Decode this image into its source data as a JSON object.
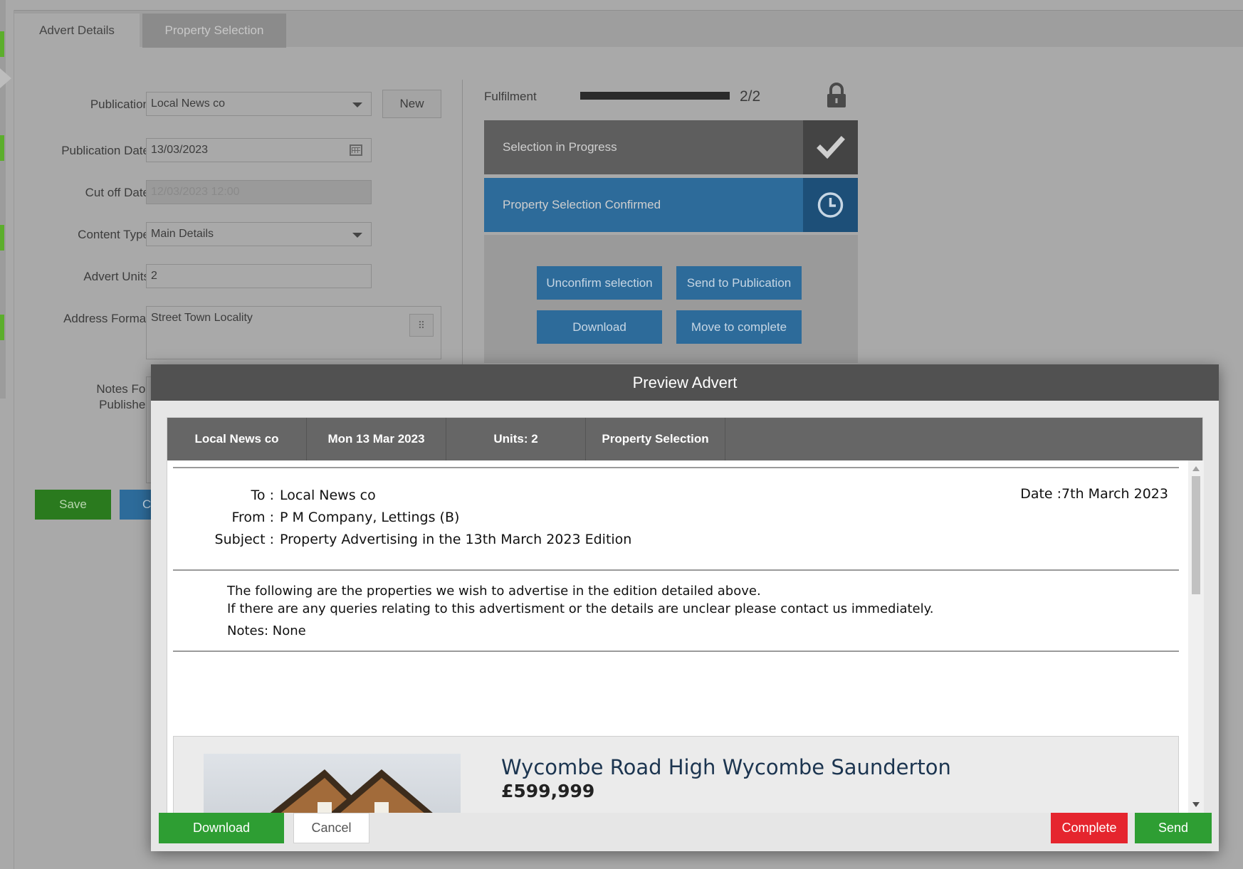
{
  "tabs": {
    "advert_details": "Advert Details",
    "property_selection": "Property Selection"
  },
  "form": {
    "publication": {
      "label": "Publication",
      "value": "Local News co"
    },
    "new_button": "New",
    "publication_date": {
      "label": "Publication Date",
      "value": "13/03/2023"
    },
    "cut_off_date": {
      "label": "Cut off Date",
      "value": "12/03/2023 12:00"
    },
    "content_type": {
      "label": "Content Type",
      "value": "Main Details"
    },
    "advert_units": {
      "label": "Advert Units",
      "value": "2"
    },
    "address_format": {
      "label": "Address Format",
      "value": "Street Town Locality"
    },
    "notes_label_line1": "Notes For",
    "notes_label_line2": "Publisher",
    "save_button": "Save",
    "cancel_button_partial": "C"
  },
  "fulfilment": {
    "label": "Fulfilment",
    "fraction": "2/2",
    "progress": 1.0,
    "stages": [
      {
        "label": "Selection in Progress",
        "icon": "check-icon"
      },
      {
        "label": "Property Selection Confirmed",
        "icon": "clock-icon"
      }
    ],
    "actions": {
      "unconfirm": "Unconfirm selection",
      "send_to_publication": "Send to Publication",
      "download": "Download",
      "move_to_complete": "Move to complete"
    }
  },
  "modal": {
    "title": "Preview Advert",
    "info": {
      "publication": "Local News co",
      "date": "Mon 13 Mar 2023",
      "units": "Units: 2",
      "section": "Property Selection"
    },
    "letter": {
      "to_key": "To :",
      "to_value": "Local News co",
      "from_key": "From :",
      "from_value": "P M Company, Lettings (B)",
      "subject_key": "Subject :",
      "subject_value": "Property Advertising in the 13th March 2023 Edition",
      "date": "Date :7th March 2023",
      "line1": "The following are the properties we wish to advertise in the edition detailed above.",
      "line2": "If there are any queries relating to this advertisment or the details are unclear please contact us immediately.",
      "notes": "Notes: None"
    },
    "property": {
      "title": "Wycombe Road High Wycombe Saunderton",
      "price": "£599,999"
    },
    "buttons": {
      "download": "Download",
      "cancel": "Cancel",
      "complete": "Complete",
      "send": "Send"
    }
  },
  "colors": {
    "primary_blue": "#2d6b9a",
    "success_green": "#2e9e33",
    "danger_red": "#e5252e",
    "modal_header": "#515151"
  }
}
